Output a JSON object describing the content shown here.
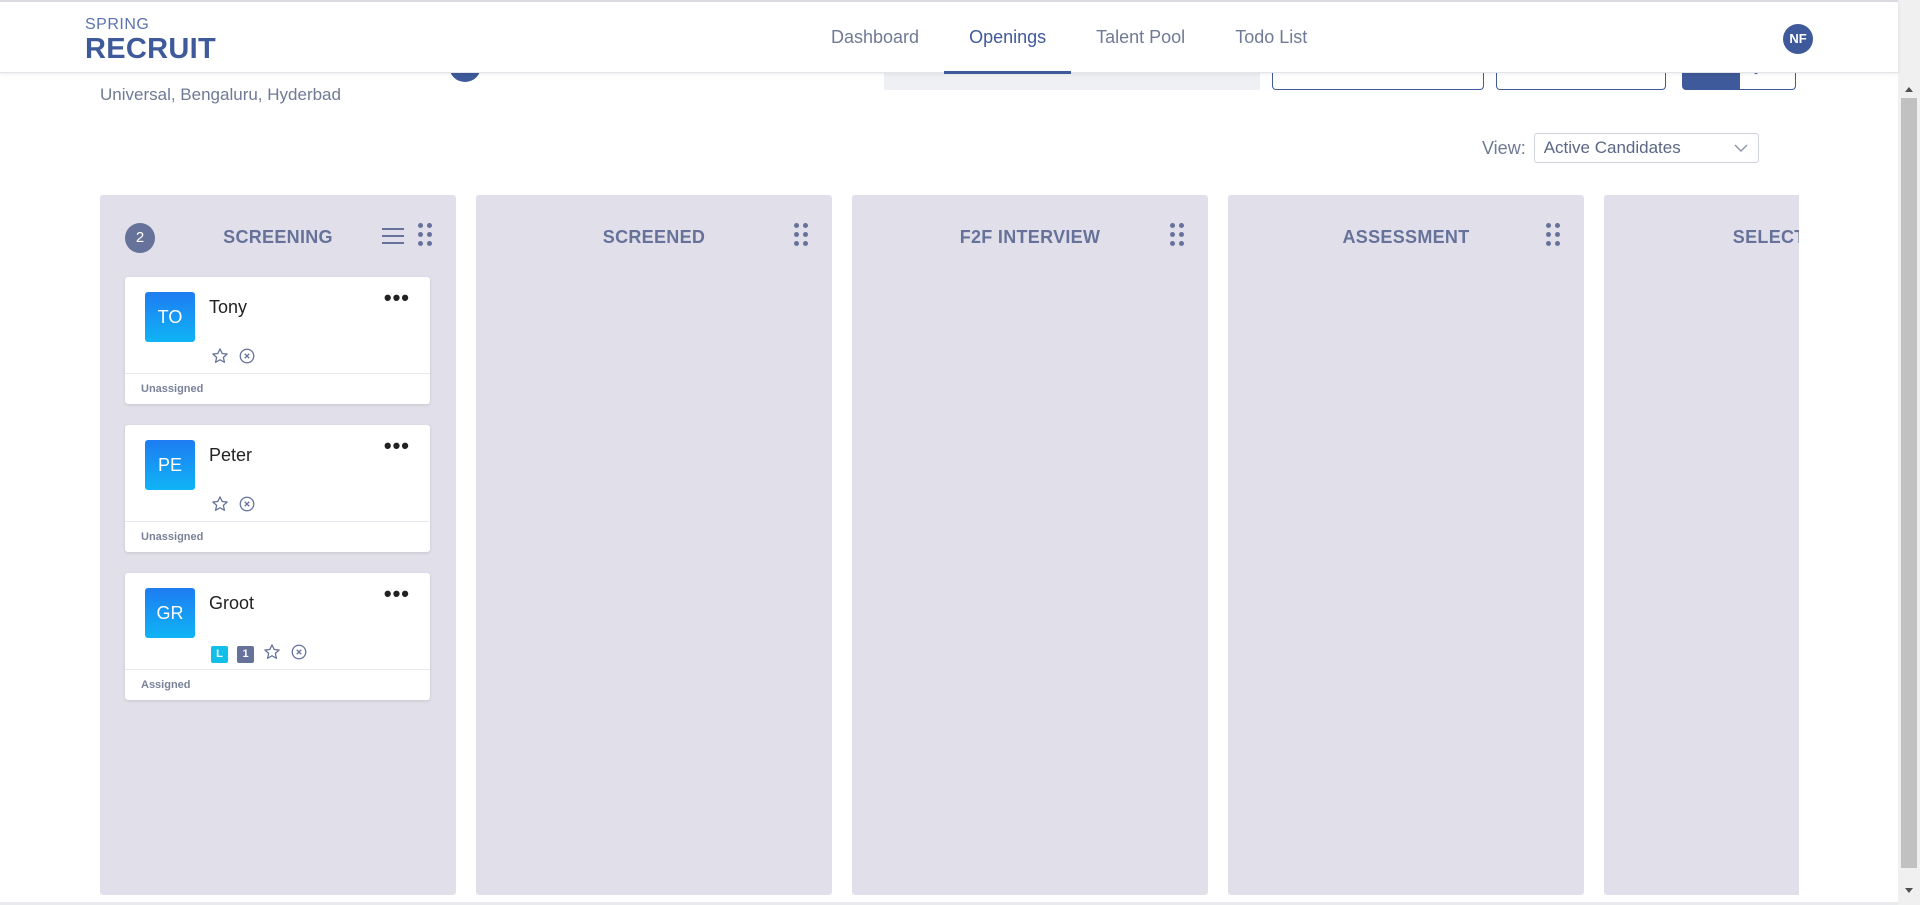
{
  "header": {
    "logo_top": "SPRING",
    "logo_bottom": "RECRUIT",
    "nav": [
      {
        "label": "Dashboard",
        "active": false
      },
      {
        "label": "Openings",
        "active": true
      },
      {
        "label": "Talent Pool",
        "active": false
      },
      {
        "label": "Todo List",
        "active": false
      }
    ],
    "user_initials": "NF"
  },
  "job": {
    "location": "Universal, Bengaluru, Hyderbad"
  },
  "view": {
    "label": "View:",
    "selected": "Active Candidates"
  },
  "columns": [
    {
      "title": "SCREENING",
      "count": "2",
      "cards": [
        {
          "initials": "TO",
          "name": "Tony",
          "status": "Unassigned",
          "tags": []
        },
        {
          "initials": "PE",
          "name": "Peter",
          "status": "Unassigned",
          "tags": []
        },
        {
          "initials": "GR",
          "name": "Groot",
          "status": "Assigned",
          "tags": [
            "L",
            "1"
          ]
        }
      ]
    },
    {
      "title": "SCREENED",
      "cards": []
    },
    {
      "title": "F2F INTERVIEW",
      "cards": []
    },
    {
      "title": "ASSESSMENT",
      "cards": []
    },
    {
      "title": "SELECTED",
      "cards": []
    }
  ],
  "colors": {
    "brand": "#3f5a9a",
    "column_bg": "#e1e0ea",
    "avatar_gradient_top": "#1e7cf2",
    "avatar_gradient_bottom": "#0fb4f5",
    "tag_l": "#12bfe8",
    "tag_count": "#66729a"
  }
}
